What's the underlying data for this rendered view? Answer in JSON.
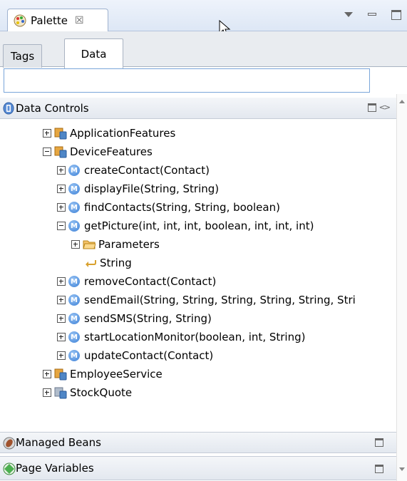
{
  "view": {
    "tab_label": "Palette",
    "tab_close": "☒"
  },
  "subtabs": [
    "Tags",
    "Data"
  ],
  "search": {
    "value": "",
    "placeholder": ""
  },
  "sections": {
    "data_controls": "Data Controls",
    "managed_beans": "Managed Beans",
    "page_variables": "Page Variables"
  },
  "tree": [
    {
      "label": "ApplicationFeatures",
      "kind": "datacontrol",
      "expanded": false
    },
    {
      "label": "DeviceFeatures",
      "kind": "datacontrol",
      "expanded": true
    },
    {
      "label": "createContact(Contact)",
      "kind": "method",
      "expanded": false
    },
    {
      "label": "displayFile(String, String)",
      "kind": "method",
      "expanded": false
    },
    {
      "label": "findContacts(String, String, boolean)",
      "kind": "method",
      "expanded": false
    },
    {
      "label": "getPicture(int, int, int, boolean, int, int, int)",
      "kind": "method",
      "expanded": true
    },
    {
      "label": "Parameters",
      "kind": "folder",
      "expanded": false
    },
    {
      "label": "String",
      "kind": "return"
    },
    {
      "label": "removeContact(Contact)",
      "kind": "method",
      "expanded": false
    },
    {
      "label": "sendEmail(String, String, String, String, String, Stri",
      "kind": "method",
      "expanded": false
    },
    {
      "label": "sendSMS(String, String)",
      "kind": "method",
      "expanded": false
    },
    {
      "label": "startLocationMonitor(boolean, int, String)",
      "kind": "method",
      "expanded": false
    },
    {
      "label": "updateContact(Contact)",
      "kind": "method",
      "expanded": false
    },
    {
      "label": "EmployeeService",
      "kind": "datacontrol",
      "expanded": false
    },
    {
      "label": "StockQuote",
      "kind": "datacontrol",
      "expanded": false
    }
  ]
}
